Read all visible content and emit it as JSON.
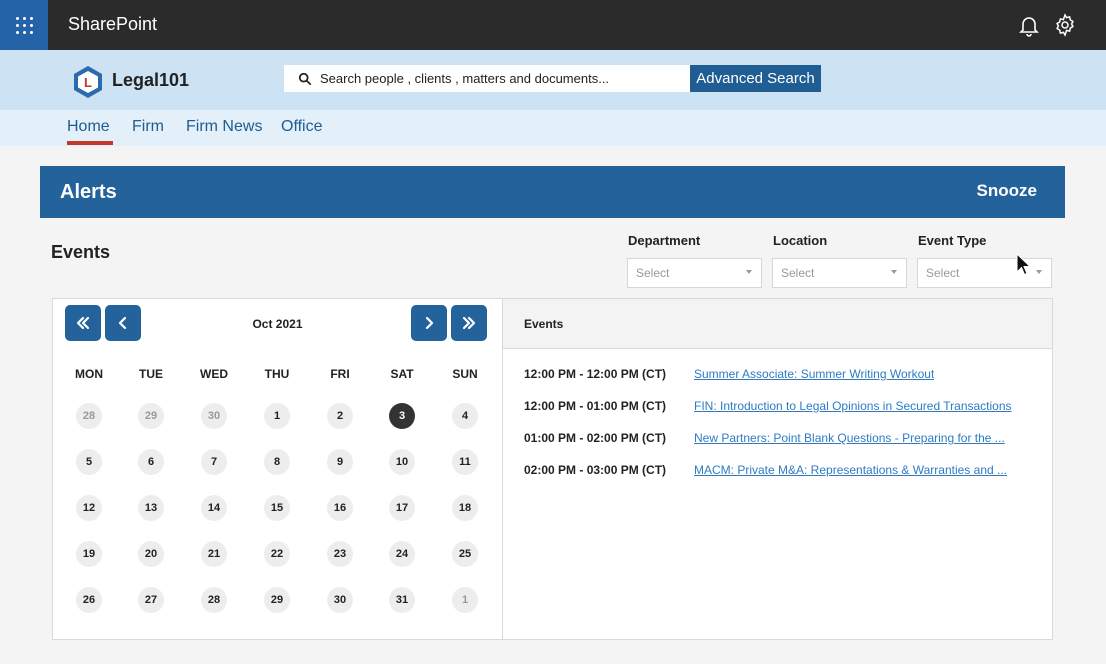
{
  "topbar": {
    "brand": "SharePoint"
  },
  "site": {
    "name": "Legal101"
  },
  "search": {
    "placeholder": "Search people , clients , matters and documents...",
    "advanced_label": "Advanced Search"
  },
  "nav": {
    "items": [
      "Home",
      "Firm",
      "Firm News",
      "Office"
    ],
    "active": "Home"
  },
  "alerts": {
    "title": "Alerts",
    "snooze_label": "Snooze"
  },
  "events_section": {
    "title": "Events",
    "filters": [
      {
        "label": "Department",
        "value": "Select"
      },
      {
        "label": "Location",
        "value": "Select"
      },
      {
        "label": "Event Type",
        "value": "Select"
      }
    ]
  },
  "calendar": {
    "month_label": "Oct 2021",
    "weekdays": [
      "MON",
      "TUE",
      "WED",
      "THU",
      "FRI",
      "SAT",
      "SUN"
    ],
    "weeks": [
      [
        {
          "d": "28",
          "o": true
        },
        {
          "d": "29",
          "o": true
        },
        {
          "d": "30",
          "o": true
        },
        {
          "d": "1"
        },
        {
          "d": "2"
        },
        {
          "d": "3",
          "t": true
        },
        {
          "d": "4"
        }
      ],
      [
        {
          "d": "5"
        },
        {
          "d": "6"
        },
        {
          "d": "7"
        },
        {
          "d": "8"
        },
        {
          "d": "9"
        },
        {
          "d": "10"
        },
        {
          "d": "11"
        }
      ],
      [
        {
          "d": "12"
        },
        {
          "d": "13"
        },
        {
          "d": "14"
        },
        {
          "d": "15"
        },
        {
          "d": "16"
        },
        {
          "d": "17"
        },
        {
          "d": "18"
        }
      ],
      [
        {
          "d": "19"
        },
        {
          "d": "20"
        },
        {
          "d": "21"
        },
        {
          "d": "22"
        },
        {
          "d": "23"
        },
        {
          "d": "24"
        },
        {
          "d": "25"
        }
      ],
      [
        {
          "d": "26"
        },
        {
          "d": "27"
        },
        {
          "d": "28"
        },
        {
          "d": "29"
        },
        {
          "d": "30"
        },
        {
          "d": "31"
        },
        {
          "d": "1",
          "o": true
        }
      ]
    ]
  },
  "event_list": {
    "header": "Events",
    "items": [
      {
        "time": "12:00 PM - 12:00 PM (CT)",
        "title": "Summer Associate: Summer Writing Workout"
      },
      {
        "time": "12:00 PM - 01:00 PM (CT)",
        "title": "FIN: Introduction to Legal Opinions in Secured Transactions"
      },
      {
        "time": "01:00 PM - 02:00 PM (CT)",
        "title": "New Partners: Point Blank Questions - Preparing for the ..."
      },
      {
        "time": "02:00 PM - 03:00 PM (CT)",
        "title": "MACM: Private M&A: Representations & Warranties and ..."
      }
    ]
  },
  "colors": {
    "primary": "#24629b",
    "header_bg": "#cde3f4",
    "topbar": "#2b2b2b",
    "link": "#2f7bc1",
    "nav_underline": "#c0392b"
  },
  "icons": [
    "waffle-icon",
    "bell-icon",
    "gear-icon",
    "search-icon",
    "double-chevron-left-icon",
    "chevron-left-icon",
    "chevron-right-icon",
    "double-chevron-right-icon",
    "mouse-cursor-icon"
  ]
}
